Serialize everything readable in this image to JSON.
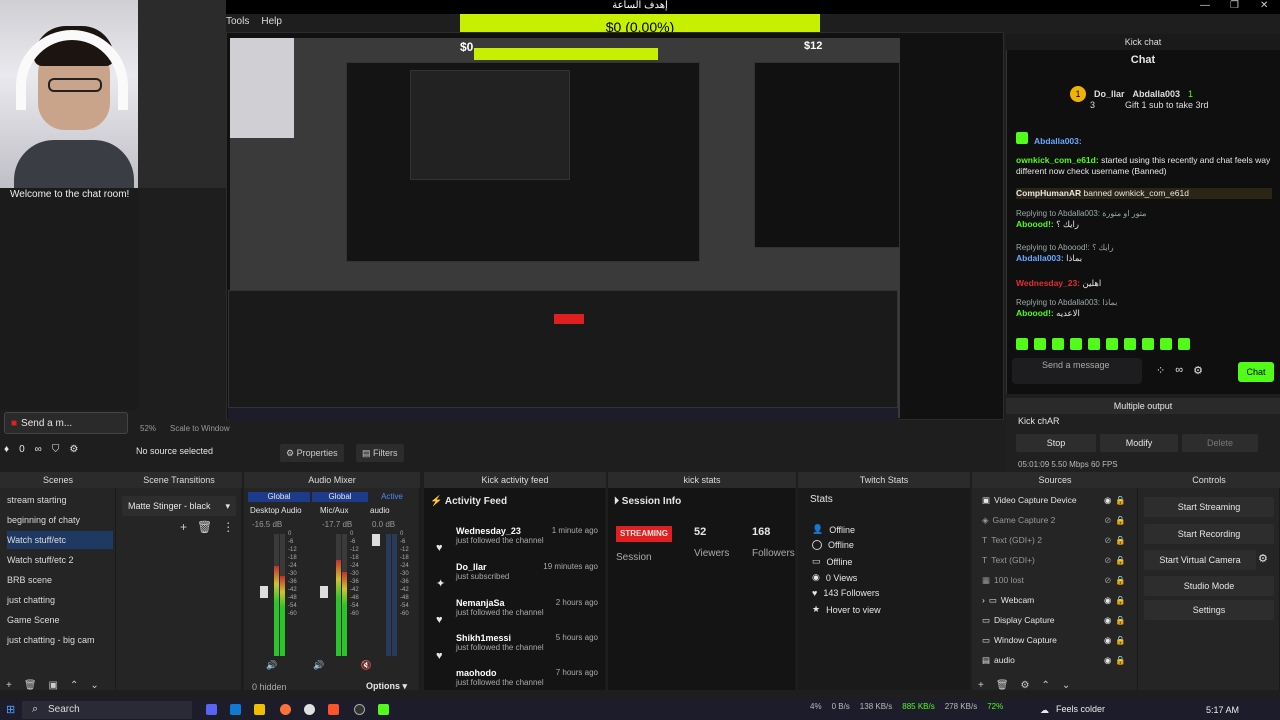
{
  "menu": [
    "Tools",
    "Help"
  ],
  "goal": {
    "title": "إهدف الساعة",
    "amount": "$0 (0.00%)",
    "left": "$0",
    "right": "$12"
  },
  "left_chat": {
    "welcome": "Welcome to the chat room!",
    "input": "Send a m...",
    "count": "0"
  },
  "preview": {
    "zoom": "52%",
    "scale": "Scale to Window",
    "no_source": "No source selected",
    "properties": "Properties",
    "filters": "Filters"
  },
  "kick_chat": {
    "dock_title": "Kick chat",
    "title": "Chat",
    "top_user": "Do_llar",
    "sub_user": "Abdalla003",
    "sub_count": "1",
    "sub_note": "Gift 1 sub to take 3rd",
    "sub_rank": "3",
    "messages": [
      {
        "user": "Abdalla003:",
        "text": ""
      },
      {
        "user": "ownkick_com_e61d:",
        "text": "started using this recently and chat feels way different now check username (Banned)"
      },
      {
        "user": "CompHumanAR",
        "text": "banned ownkick_com_e61d"
      },
      {
        "reply": "Replying to Abdalla003: متور او متورة",
        "user": "Aboood!:",
        "text": "رايك ؟"
      },
      {
        "reply": "Replying to Aboood!: رايك ؟",
        "user": "Abdalla003:",
        "text": "بماذا"
      },
      {
        "user": "Wednesday_23:",
        "text": "اهلين"
      },
      {
        "reply": "Replying to Abdalla003: بماذا",
        "user": "Aboood!:",
        "text": "الاعديه"
      }
    ],
    "input": "Send a message",
    "send": "Chat"
  },
  "multiple_output": {
    "title": "Multiple output",
    "name": "Kick chAR",
    "stop": "Stop",
    "modify": "Modify",
    "delete": "Delete",
    "stats": "05:01:09  5.50 Mbps  60 FPS"
  },
  "docks": {
    "scenes": "Scenes",
    "transitions": "Scene Transitions",
    "mixer": "Audio Mixer",
    "activity": "Kick activity feed",
    "kickstats": "kick stats",
    "twitch": "Twitch Stats",
    "sources": "Sources",
    "controls": "Controls"
  },
  "scenes": [
    "stream starting",
    "beginning of chaty",
    "Watch stuff/etc",
    "Watch stuff/etc 2",
    "BRB scene",
    "just chatting",
    "Game Scene",
    "just chatting - big cam"
  ],
  "active_scene_index": 2,
  "transition": {
    "value": "Matte Stinger - black"
  },
  "mixer": {
    "channels": [
      {
        "scope": "Global",
        "name": "Desktop Audio",
        "db": "-16.5 dB"
      },
      {
        "scope": "Global",
        "name": "Mic/Aux",
        "db": "-17.7 dB"
      },
      {
        "scope": "Active",
        "name": "audio",
        "db": "0.0 dB"
      }
    ],
    "scale": [
      "0",
      "-6",
      "-12",
      "-18",
      "-24",
      "-30",
      "-36",
      "-42",
      "-48",
      "-54",
      "-60"
    ],
    "hidden": "0 hidden",
    "options": "Options"
  },
  "activity": {
    "header": "Activity Feed",
    "items": [
      {
        "name": "Wednesday_23",
        "sub": "just followed the channel",
        "time": "1 minute ago"
      },
      {
        "name": "Do_llar",
        "sub": "just subscribed",
        "time": "19 minutes ago"
      },
      {
        "name": "NemanjaSa",
        "sub": "just followed the channel",
        "time": "2 hours ago"
      },
      {
        "name": "Shikh1messi",
        "sub": "just followed the channel",
        "time": "5 hours ago"
      },
      {
        "name": "maohodo",
        "sub": "just followed the channel",
        "time": "7 hours ago"
      }
    ]
  },
  "kickstats": {
    "header": "Session Info",
    "badge": "STREAMING",
    "session": "Session",
    "viewers_num": "52",
    "viewers": "Viewers",
    "followers_num": "168",
    "followers": "Followers"
  },
  "twitch": {
    "header": "Stats",
    "rows": [
      "Offline",
      "Offline",
      "Offline",
      "0 Views",
      "143 Followers",
      "Hover to view"
    ]
  },
  "sources": [
    "Video Capture Device",
    "Game Capture 2",
    "Text (GDI+) 2",
    "Text (GDI+)",
    "100 lost",
    "Webcam",
    "Display Capture",
    "Window Capture",
    "audio"
  ],
  "controls": [
    "Start Streaming",
    "Start Recording",
    "Start Virtual Camera",
    "Studio Mode",
    "Settings"
  ],
  "taskbar": {
    "search": "Search",
    "weather": "Feels colder",
    "time": "5:17 AM",
    "net_up": "0 B/s",
    "net_down": "138 KB/s",
    "tx": "885 KB/s",
    "rx": "278 KB/s",
    "cpu": "72%",
    "pct": "4%"
  },
  "colors": {
    "kick_green": "#53fc18",
    "goal_yellow": "#c7f000",
    "streaming_red": "#e02020",
    "active_blue": "#1e3a62"
  }
}
